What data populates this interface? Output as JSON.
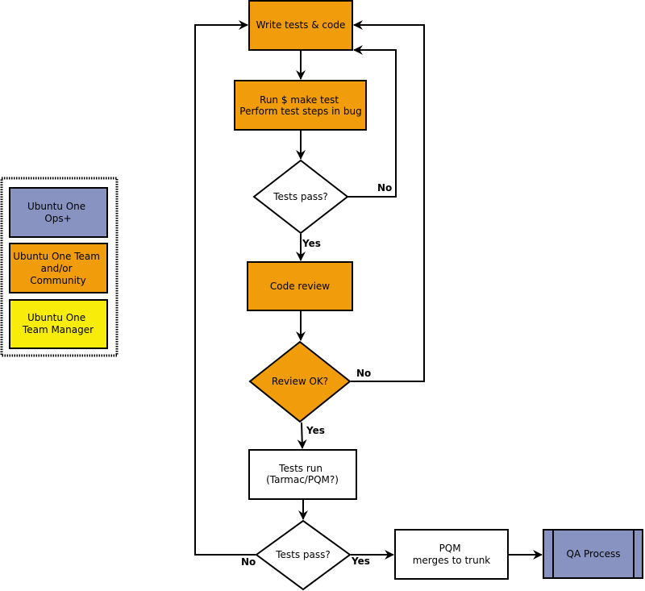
{
  "colors": {
    "ops": "#8993c2",
    "team": "#f19c0a",
    "manager": "#f8ec0b",
    "plain": "#ffffff",
    "line": "#000000"
  },
  "legend": {
    "items": [
      {
        "lines": [
          "Ubuntu One",
          "Ops+"
        ],
        "role": "ops"
      },
      {
        "lines": [
          "Ubuntu One Team",
          "and/or",
          "Community"
        ],
        "role": "team"
      },
      {
        "lines": [
          "Ubuntu One",
          "Team Manager"
        ],
        "role": "manager"
      }
    ]
  },
  "nodes": {
    "write": {
      "lines": [
        "Write tests & code"
      ],
      "shape": "process",
      "role": "team"
    },
    "run": {
      "lines": [
        "Run $ make test",
        "Perform test steps in bug"
      ],
      "shape": "process",
      "role": "team"
    },
    "tests_pass_1": {
      "lines": [
        "Tests pass?"
      ],
      "shape": "decision",
      "role": "plain"
    },
    "code_review": {
      "lines": [
        "Code review"
      ],
      "shape": "process",
      "role": "team"
    },
    "review_ok": {
      "lines": [
        "Review OK?"
      ],
      "shape": "decision",
      "role": "team"
    },
    "tests_run": {
      "lines": [
        "Tests run",
        "(Tarmac/PQM?)"
      ],
      "shape": "process",
      "role": "plain"
    },
    "tests_pass_2": {
      "lines": [
        "Tests pass?"
      ],
      "shape": "decision",
      "role": "plain"
    },
    "pqm": {
      "lines": [
        "PQM",
        "merges to trunk"
      ],
      "shape": "process",
      "role": "plain"
    },
    "qa": {
      "lines": [
        "QA Process"
      ],
      "shape": "predefined-process",
      "role": "ops"
    }
  },
  "edges": [
    {
      "from": "write",
      "to": "run",
      "label": ""
    },
    {
      "from": "run",
      "to": "tests_pass_1",
      "label": ""
    },
    {
      "from": "tests_pass_1",
      "to": "write",
      "label": "No"
    },
    {
      "from": "tests_pass_1",
      "to": "code_review",
      "label": "Yes"
    },
    {
      "from": "code_review",
      "to": "review_ok",
      "label": ""
    },
    {
      "from": "review_ok",
      "to": "write",
      "label": "No"
    },
    {
      "from": "review_ok",
      "to": "tests_run",
      "label": "Yes"
    },
    {
      "from": "tests_run",
      "to": "tests_pass_2",
      "label": ""
    },
    {
      "from": "tests_pass_2",
      "to": "write",
      "label": "No"
    },
    {
      "from": "tests_pass_2",
      "to": "pqm",
      "label": "Yes"
    },
    {
      "from": "pqm",
      "to": "qa",
      "label": ""
    }
  ]
}
